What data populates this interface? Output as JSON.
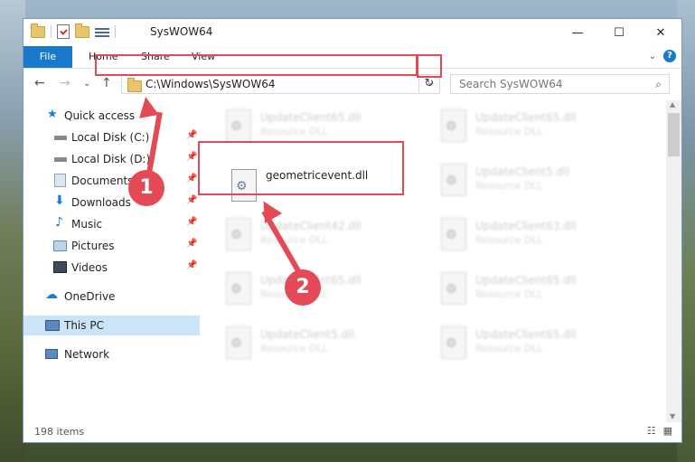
{
  "window": {
    "title": "SysWOW64"
  },
  "ribbon": {
    "tabs": [
      "File",
      "Home",
      "Share",
      "View"
    ],
    "expand": "⌄",
    "help": "?"
  },
  "controls": {
    "minimize": "—",
    "maximize": "☐",
    "close": "✕"
  },
  "nav": {
    "back": "←",
    "forward": "→",
    "recent": "⌄",
    "up": "↑",
    "refresh": "↻"
  },
  "address": {
    "path": "C:\\Windows\\SysWOW64",
    "dropdown": "⌄"
  },
  "search": {
    "placeholder": "Search SysWOW64",
    "icon": "⌕"
  },
  "sidebar": {
    "items": [
      {
        "label": "Quick access",
        "icon": "star-icon",
        "pinned": false
      },
      {
        "label": "Local Disk (C:)",
        "icon": "drive-icon",
        "pinned": true
      },
      {
        "label": "Local Disk (D:)",
        "icon": "drive-icon",
        "pinned": true
      },
      {
        "label": "Documents",
        "icon": "documents-icon",
        "pinned": true
      },
      {
        "label": "Downloads",
        "icon": "download-icon",
        "pinned": true
      },
      {
        "label": "Music",
        "icon": "music-icon",
        "pinned": true
      },
      {
        "label": "Pictures",
        "icon": "pictures-icon",
        "pinned": true
      },
      {
        "label": "Videos",
        "icon": "videos-icon",
        "pinned": true
      },
      {
        "label": "OneDrive",
        "icon": "cloud-icon",
        "pinned": false
      },
      {
        "label": "This PC",
        "icon": "computer-icon",
        "pinned": false
      },
      {
        "label": "Network",
        "icon": "network-icon",
        "pinned": false
      }
    ],
    "pin_glyph": "📌"
  },
  "files": [
    {
      "name": "UpdateClient65.dll",
      "desc": "Resource DLL"
    },
    {
      "name": "UpdateClient65.dll",
      "desc": "Resource DLL"
    },
    {
      "name": "geometricevent.dll",
      "desc": ""
    },
    {
      "name": "UpdateClient5.dll",
      "desc": "Resource DLL"
    },
    {
      "name": "UpdateClient42.dll",
      "desc": "Resource DLL"
    },
    {
      "name": "UpdateClient63.dll",
      "desc": "Resource DLL"
    },
    {
      "name": "UpdateClient65.dll",
      "desc": "Resource DLL"
    },
    {
      "name": "UpdateClient65.dll",
      "desc": "Resource DLL"
    },
    {
      "name": "UpdateClient5.dll",
      "desc": "Resource DLL"
    },
    {
      "name": "UpdateClient65.dll",
      "desc": "Resource DLL"
    }
  ],
  "status": {
    "count": "198 items",
    "view_details": "☷",
    "view_tiles": "▦"
  },
  "annotations": {
    "step1": "1",
    "step2": "2"
  },
  "colors": {
    "accent": "#1979ca",
    "highlight": "#e44a55"
  }
}
